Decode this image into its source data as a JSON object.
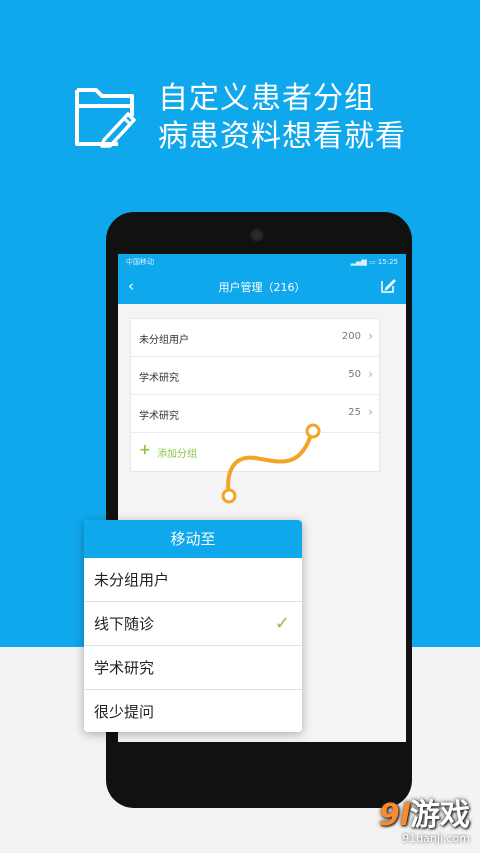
{
  "headline": {
    "line1": "自定义患者分组",
    "line2": "病患资料想看就看"
  },
  "status": {
    "carrier": "中国移动",
    "time": "15:25"
  },
  "appbar": {
    "back_label": "‹",
    "title": "用户管理（216）"
  },
  "groups": [
    {
      "label": "未分组用户",
      "count": "200"
    },
    {
      "label": "学术研究",
      "count": "50"
    },
    {
      "label": "学术研究",
      "count": "25"
    }
  ],
  "add_group": {
    "icon": "+",
    "label": "添加分组"
  },
  "move_dialog": {
    "title": "移动至",
    "items": [
      {
        "label": "未分组用户"
      },
      {
        "label": "线下随诊",
        "checked": "✓"
      },
      {
        "label": "学术研究"
      },
      {
        "label": "很少提问"
      }
    ]
  },
  "watermark": {
    "logo_num": "9l",
    "logo_text": "游戏",
    "url": "91danji.com"
  },
  "colors": {
    "brand": "#10a8ec",
    "accent": "#8ac43f",
    "curve": "#f5a327"
  }
}
